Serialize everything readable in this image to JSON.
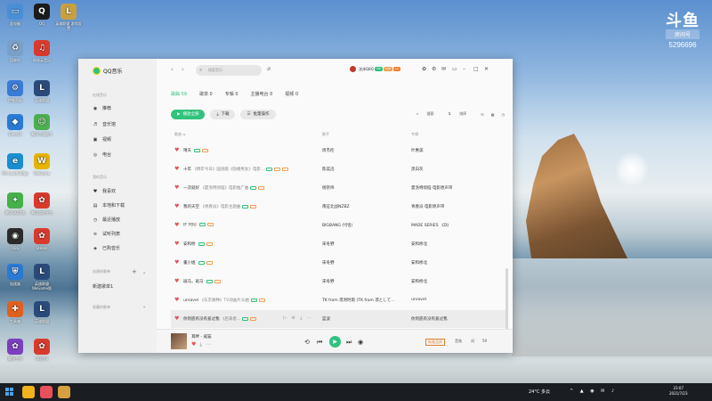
{
  "desktop": {
    "watermark_logo": "斗鱼",
    "watermark_label": "房间号",
    "watermark_room": "5296696",
    "icons": [
      {
        "label": "此电脑",
        "color": "#4a8fd6",
        "glyph": "▭"
      },
      {
        "label": "QQ",
        "color": "#1b1b1b",
        "glyph": "Q"
      },
      {
        "label": "英雄联盟\n游戏设置",
        "color": "#c8a040",
        "glyph": "L"
      },
      {
        "label": "回收站",
        "color": "#7aa0c8",
        "glyph": "♻"
      },
      {
        "label": "网易云音乐",
        "color": "#d83a2e",
        "glyph": "♫"
      },
      {
        "label": "控制面板",
        "color": "#3a7bd5",
        "glyph": "⚙"
      },
      {
        "label": "英雄联盟",
        "color": "#2a4a7a",
        "glyph": "L"
      },
      {
        "label": "DirectX",
        "color": "#2a7ad5",
        "glyph": "◆"
      },
      {
        "label": "腾讯手游助手",
        "color": "#4caf50",
        "glyph": "☺"
      },
      {
        "label": "Microsoft Edge",
        "color": "#1a8fd0",
        "glyph": "e"
      },
      {
        "label": "WeGame",
        "color": "#e6b400",
        "glyph": "W"
      },
      {
        "label": "腾讯QQ游戏",
        "color": "#46b04a",
        "glyph": "✦"
      },
      {
        "label": "腾讯游戏平台",
        "color": "#d83a2e",
        "glyph": "✿"
      },
      {
        "label": "OBS",
        "color": "#2b2b2b",
        "glyph": "◉"
      },
      {
        "label": "Steam",
        "color": "#d83a2e",
        "glyph": "✿"
      },
      {
        "label": "加速器",
        "color": "#2a7ad5",
        "glyph": "⛨"
      },
      {
        "label": "英雄联盟WeGame版",
        "color": "#2a4a7a",
        "glyph": "L"
      },
      {
        "label": "工具箱",
        "color": "#e06020",
        "glyph": "✚"
      },
      {
        "label": "英雄联盟",
        "color": "#2a4a7a",
        "glyph": "L"
      },
      {
        "label": "腾讯手游",
        "color": "#7b3fbf",
        "glyph": "✿"
      },
      {
        "label": "QQ音乐",
        "color": "#d83a2e",
        "glyph": "✿"
      }
    ]
  },
  "app": {
    "name": "QQ音乐",
    "sidebar": {
      "section_online": "在线音乐",
      "online_items": [
        {
          "label": "推荐",
          "icon": "◉"
        },
        {
          "label": "音乐馆",
          "icon": "♬"
        },
        {
          "label": "视频",
          "icon": "▣"
        },
        {
          "label": "电台",
          "icon": "◎"
        }
      ],
      "section_mine": "我的音乐",
      "mine_items": [
        {
          "label": "我喜欢",
          "icon": "♥"
        },
        {
          "label": "本地和下载",
          "icon": "▤"
        },
        {
          "label": "最近播放",
          "icon": "◷"
        },
        {
          "label": "试听列表",
          "icon": "≡"
        },
        {
          "label": "已购音乐",
          "icon": "◈"
        }
      ],
      "section_created": "创建的歌单",
      "created_items": [
        {
          "label": "新建歌单1"
        }
      ],
      "section_collected": "收藏的歌单"
    },
    "topbar": {
      "search_placeholder": "搜索音乐",
      "username": "沈泽Q8Q",
      "badges": [
        "VIP",
        "SVIP",
        "LV"
      ]
    },
    "tabs": [
      {
        "label": "歌曲 59",
        "active": true
      },
      {
        "label": "歌单 0",
        "active": false
      },
      {
        "label": "专辑 0",
        "active": false
      },
      {
        "label": "主播电台 0",
        "active": false
      },
      {
        "label": "视频 0",
        "active": false
      }
    ],
    "buttons": {
      "play_all": "播放全部",
      "download": "下载",
      "batch": "批量操作"
    },
    "tools": {
      "search": "搜索",
      "sort": "排序"
    },
    "columns": {
      "title": "歌曲 ≑",
      "singer": "歌手",
      "album": "专辑"
    },
    "songs": [
      {
        "title": "晴天",
        "sub": "",
        "tags": [
          "g",
          "o"
        ],
        "singer": "周杰伦",
        "album": "叶惠美"
      },
      {
        "title": "十年",
        "sub": "《明年今日》国语版《隐婚男女》电影…",
        "tags": [
          "g",
          "o",
          "o"
        ],
        "singer": "陈奕迅",
        "album": "黑白灰"
      },
      {
        "title": "一次就好",
        "sub": "《夏洛特烦恼》电影推广曲",
        "tags": [
          "g",
          "o"
        ],
        "singer": "杨宗纬",
        "album": "夏洛特烦恼 电影原声带"
      },
      {
        "title": "我的天空",
        "sub": "《青春派》电影主题曲",
        "tags": [
          "g",
          "o"
        ],
        "singer": "南征北战NZBZ",
        "album": "青春派 电影原声带"
      },
      {
        "title": "IF YOU",
        "sub": "",
        "tags": [
          "g",
          "o"
        ],
        "singer": "BIGBANG (빅뱅)",
        "album": "MADE SERIES 《D》"
      },
      {
        "title": "安和桥",
        "sub": "",
        "tags": [
          "g",
          "o"
        ],
        "singer": "宋冬野",
        "album": "安和桥北"
      },
      {
        "title": "董小姐",
        "sub": "",
        "tags": [
          "g",
          "o"
        ],
        "singer": "宋冬野",
        "album": "安和桥北"
      },
      {
        "title": "斑马，斑马",
        "sub": "",
        "tags": [
          "g",
          "o"
        ],
        "singer": "宋冬野",
        "album": "安和桥北"
      },
      {
        "title": "unravel",
        "sub": "《东京喰种》TV动画片头曲",
        "tags": [
          "g",
          "o"
        ],
        "singer": "TK from 凛冽时雨 (TK from 凛として…",
        "album": "unravel"
      },
      {
        "title": "你到底有没有爱过我",
        "sub": "《后来者…",
        "tags": [
          "g",
          "o"
        ],
        "singer": "蓝波",
        "album": "你到底有没有爱过我"
      }
    ],
    "player": {
      "song": "耳畔",
      "artist": "威猫",
      "quality": "标准品质",
      "effects": "音效",
      "count": "59",
      "lyric": "词"
    }
  },
  "taskbar": {
    "weather": "24°C 多云",
    "time": "23:07",
    "date": "2021/7/23"
  }
}
